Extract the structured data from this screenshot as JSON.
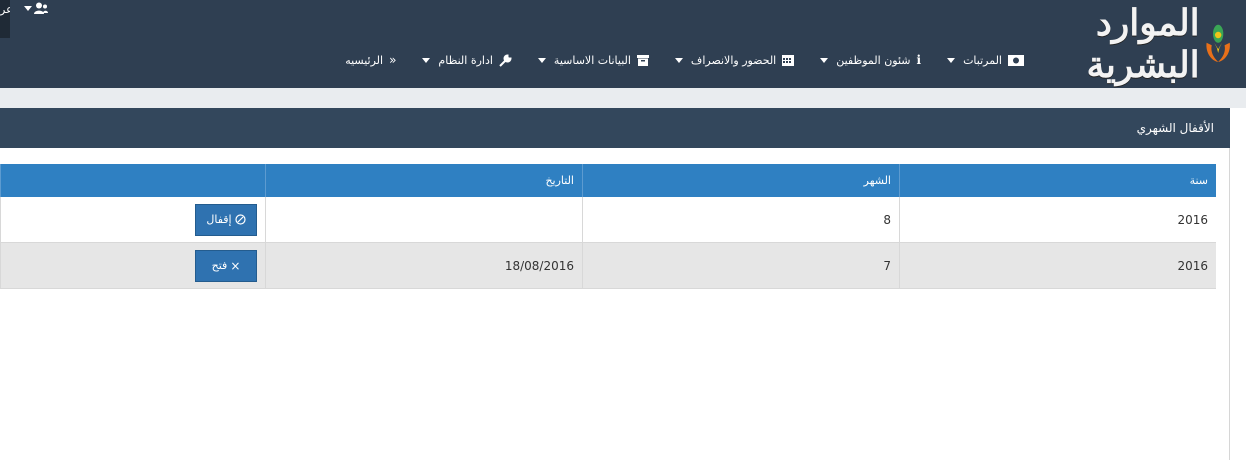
{
  "header": {
    "logo_text": "الموارد البشرية",
    "user_menu_label": "عر",
    "nav": [
      {
        "label": "الرئيسيه",
        "icon": "double-chevron-icon"
      },
      {
        "label": "ادارة النظام",
        "icon": "wrench-icon"
      },
      {
        "label": "البيانات الاساسية",
        "icon": "archive-icon"
      },
      {
        "label": "الحضور والانصراف",
        "icon": "calendar-icon"
      },
      {
        "label": "شئون الموظفين",
        "icon": "info-icon"
      },
      {
        "label": "المرتبات",
        "icon": "money-icon"
      }
    ]
  },
  "panel": {
    "title": "الأقفال الشهري"
  },
  "table": {
    "columns": [
      "سنة",
      "الشهر",
      "التاريخ",
      ""
    ],
    "rows": [
      {
        "year": "2016",
        "month": "8",
        "date": "",
        "action": "إقفال",
        "action_icon": "lock-icon"
      },
      {
        "year": "2016",
        "month": "7",
        "date": "18/08/2016",
        "action": "فتح",
        "action_icon": "close-icon"
      }
    ]
  },
  "colors": {
    "topbar": "#2f3f52",
    "panel_header": "#33475c",
    "table_header": "#2f80c2",
    "button": "#2f72b0"
  }
}
